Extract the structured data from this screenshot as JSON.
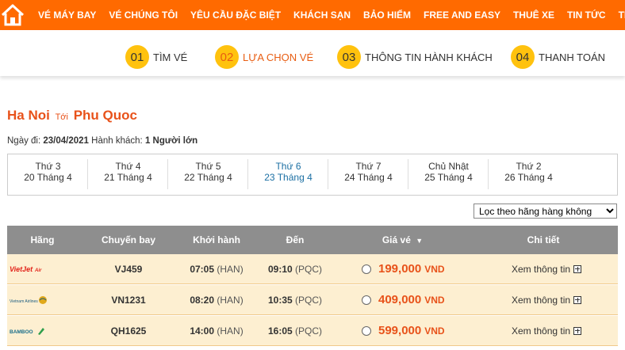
{
  "nav": {
    "items": [
      "VÉ MÁY BAY",
      "VÉ CHÚNG TÔI",
      "YÊU CẦU ĐẶC BIỆT",
      "KHÁCH SẠN",
      "BẢO HIỂM",
      "FREE AND EASY",
      "THUÊ XE",
      "TIN TỨC",
      "TIN HO"
    ]
  },
  "steps": [
    {
      "num": "01",
      "label": "TÌM VÉ"
    },
    {
      "num": "02",
      "label": "LỰA CHỌN VÉ"
    },
    {
      "num": "03",
      "label": "THÔNG TIN HÀNH KHÁCH"
    },
    {
      "num": "04",
      "label": "THANH TOÁN"
    }
  ],
  "route": {
    "from": "Ha Noi",
    "to_word": "Tới",
    "to": "Phu Quoc"
  },
  "meta": {
    "date_label": "Ngày đi:",
    "date": "23/04/2021",
    "pax_label": "Hành khách:",
    "pax": "1 Người lớn"
  },
  "dates": [
    {
      "day": "Thứ 3",
      "date": "20 Tháng 4"
    },
    {
      "day": "Thứ 4",
      "date": "21 Tháng 4"
    },
    {
      "day": "Thứ 5",
      "date": "22 Tháng 4"
    },
    {
      "day": "Thứ 6",
      "date": "23 Tháng 4"
    },
    {
      "day": "Thứ 7",
      "date": "24 Tháng 4"
    },
    {
      "day": "Chủ Nhật",
      "date": "25 Tháng 4"
    },
    {
      "day": "Thứ 2",
      "date": "26 Tháng 4"
    }
  ],
  "filter": {
    "selected": "Lọc theo hãng hàng không"
  },
  "table": {
    "headers": [
      "Hãng",
      "Chuyến bay",
      "Khởi hành",
      "Đến",
      "Giá vé",
      "Chi tiết"
    ],
    "sort_icon": "sort-desc-icon",
    "rows": [
      {
        "airline": "VietJet Air",
        "flight": "VJ459",
        "depart": "07:05",
        "depart_code": "(HAN)",
        "arrive": "09:10",
        "arrive_code": "(PQC)",
        "price": "199,000",
        "currency": "VND",
        "detail": "Xem thông tin"
      },
      {
        "airline": "Vietnam Airlines",
        "flight": "VN1231",
        "depart": "08:20",
        "depart_code": "(HAN)",
        "arrive": "10:35",
        "arrive_code": "(PQC)",
        "price": "409,000",
        "currency": "VND",
        "detail": "Xem thông tin"
      },
      {
        "airline": "Bamboo Airways",
        "flight": "QH1625",
        "depart": "14:00",
        "depart_code": "(HAN)",
        "arrive": "16:05",
        "arrive_code": "(PQC)",
        "price": "599,000",
        "currency": "VND",
        "detail": "Xem thông tin"
      }
    ]
  },
  "colors": {
    "nav": "#ff6a00",
    "accent": "#e8521a",
    "step_circle": "#ffc20e",
    "row_bg": "#fdefd1",
    "header_bg": "#8e8e8e"
  }
}
